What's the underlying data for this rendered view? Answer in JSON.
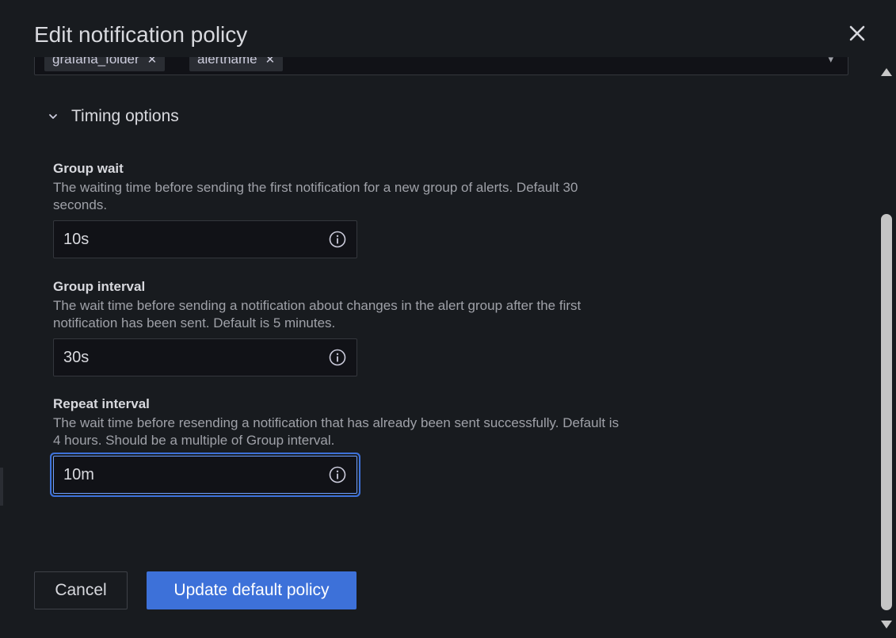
{
  "drawer": {
    "title": "Edit notification policy"
  },
  "group_by": {
    "chips": [
      {
        "label": "grafana_folder"
      },
      {
        "label": "alertname"
      }
    ]
  },
  "timing_section": {
    "title": "Timing options"
  },
  "fields": {
    "group_wait": {
      "label": "Group wait",
      "description": "The waiting time before sending the first notification for a new group of alerts. Default 30 seconds.",
      "value": "10s"
    },
    "group_interval": {
      "label": "Group interval",
      "description": "The wait time before sending a notification about changes in the alert group after the first notification has been sent. Default is 5 minutes.",
      "value": "30s"
    },
    "repeat_interval": {
      "label": "Repeat interval",
      "description": "The wait time before resending a notification that has already been sent successfully. Default is 4 hours. Should be a multiple of Group interval.",
      "value": "10m"
    }
  },
  "actions": {
    "cancel_label": "Cancel",
    "update_label": "Update default policy"
  },
  "icons": {
    "close": "close-icon",
    "chevron": "chevron-down-icon",
    "info": "info-circle-icon",
    "chip_remove": "close-icon"
  },
  "colors": {
    "background": "#181b1f",
    "input_background": "#111217",
    "primary": "#3d71d9",
    "focus_ring": "#3d71d9",
    "text": "#d8d9de",
    "secondary_text": "#9fa1a8"
  }
}
